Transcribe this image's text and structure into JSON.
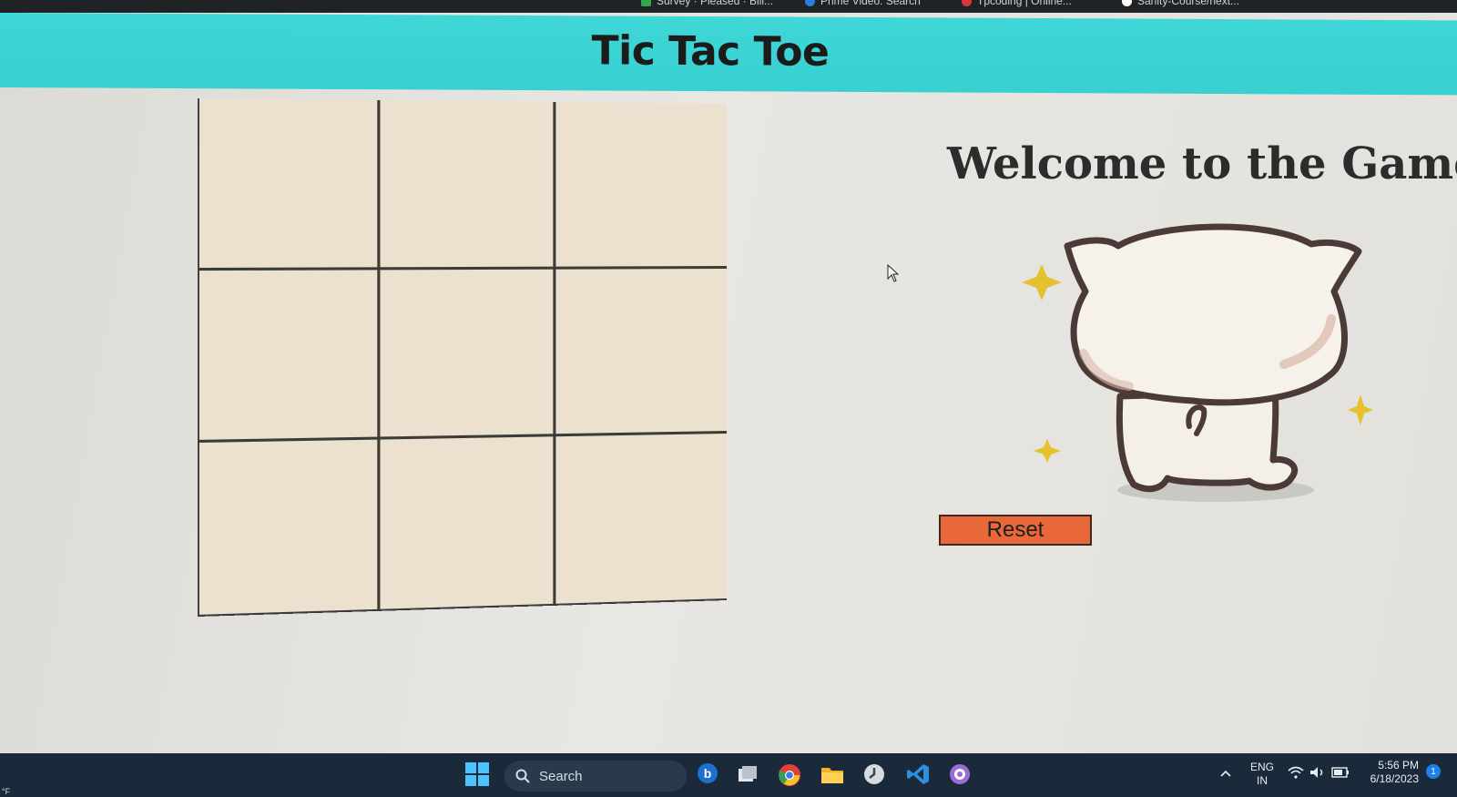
{
  "browser": {
    "bookmarks": [
      {
        "label": "Survey · Pleased · Bill...",
        "icon": "green-sheet-icon",
        "color": "#2fa84f"
      },
      {
        "label": "Prime Video: Search",
        "icon": "prime-video-icon",
        "color": "#2a7de1"
      },
      {
        "label": "Tpcoding | Online...",
        "icon": "red-logo-icon",
        "color": "#d9363e"
      },
      {
        "label": "Sanity-Course/next...",
        "icon": "github-icon",
        "color": "#ffffff"
      }
    ]
  },
  "header": {
    "title": "Tic Tac Toe",
    "color": "#3fd6d6"
  },
  "board": {
    "cells": [
      "",
      "",
      "",
      "",
      "",
      "",
      "",
      "",
      ""
    ]
  },
  "panel": {
    "welcome": "Welcome to the Game!",
    "mascot": "cat-sticker-icon",
    "reset_label": "Reset",
    "reset_color": "#e8683a"
  },
  "taskbar": {
    "search_label": "Search",
    "language": "ENG",
    "region": "IN",
    "time": "5:56 PM",
    "date": "6/18/2023",
    "notification_count": "1",
    "weather_text": "°F",
    "apps": [
      "windows-start-icon",
      "bing-icon",
      "task-view-icon",
      "chrome-icon",
      "file-explorer-icon",
      "clock-icon",
      "vscode-icon",
      "github-desktop-icon"
    ]
  }
}
